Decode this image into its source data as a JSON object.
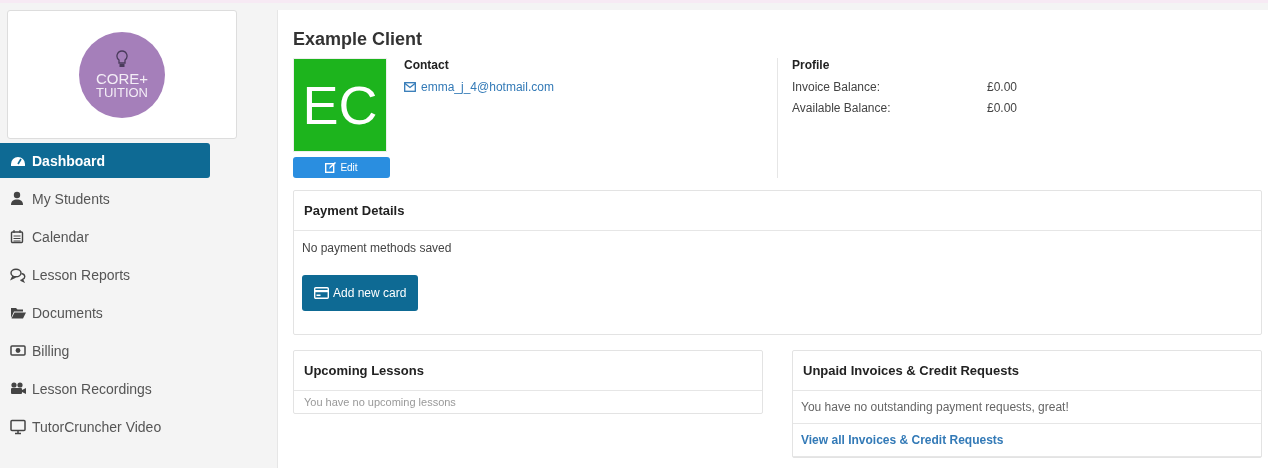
{
  "logo": {
    "line_1": "CORE+",
    "line_2": "TUITION"
  },
  "sidebar": {
    "items": [
      {
        "label": "Dashboard",
        "selected": true
      },
      {
        "label": "My Students",
        "selected": false
      },
      {
        "label": "Calendar",
        "selected": false
      },
      {
        "label": "Lesson Reports",
        "selected": false
      },
      {
        "label": "Documents",
        "selected": false
      },
      {
        "label": "Billing",
        "selected": false
      },
      {
        "label": "Lesson Recordings",
        "selected": false
      },
      {
        "label": "TutorCruncher Video",
        "selected": false
      }
    ]
  },
  "client": {
    "name": "Example Client",
    "initials": "EC",
    "edit_button": "Edit",
    "contact": {
      "heading": "Contact",
      "email": "emma_j_4@hotmail.com"
    },
    "profile": {
      "heading": "Profile",
      "rows": [
        {
          "label": "Invoice Balance:",
          "value": "£0.00"
        },
        {
          "label": "Available Balance:",
          "value": "£0.00"
        }
      ]
    }
  },
  "payment_details": {
    "title": "Payment Details",
    "message": "No payment methods saved",
    "button": "Add new card"
  },
  "upcoming_lessons": {
    "title": "Upcoming Lessons",
    "message": "You have no upcoming lessons"
  },
  "unpaid_invoices": {
    "title": "Unpaid Invoices & Credit Requests",
    "message": "You have no outstanding payment requests, great!",
    "link": "View all Invoices & Credit Requests"
  }
}
